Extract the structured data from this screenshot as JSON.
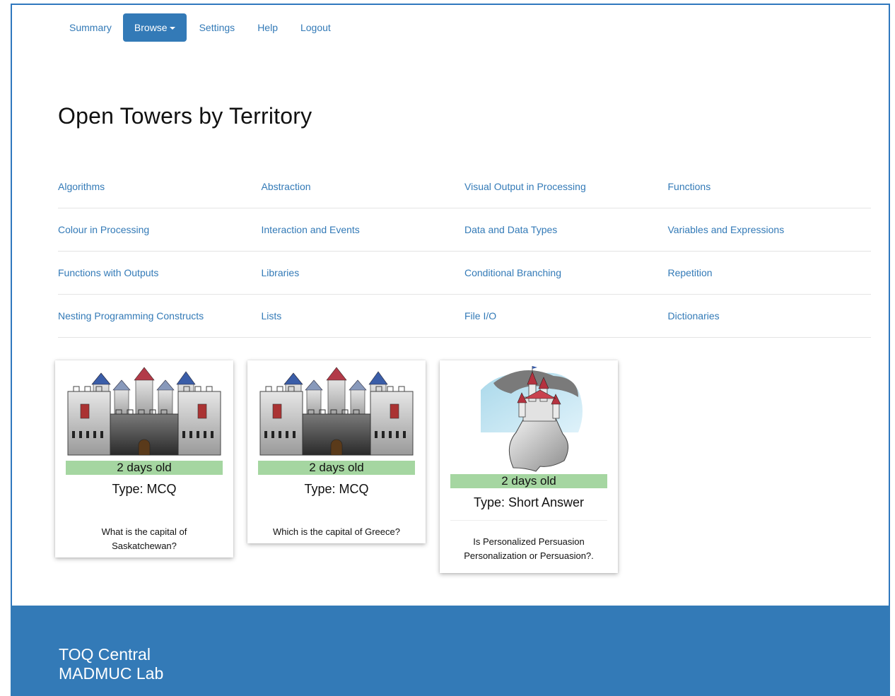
{
  "nav": {
    "items": [
      {
        "label": "Summary",
        "active": false
      },
      {
        "label": "Browse",
        "active": true,
        "dropdown": true
      },
      {
        "label": "Settings",
        "active": false
      },
      {
        "label": "Help",
        "active": false
      },
      {
        "label": "Logout",
        "active": false
      }
    ]
  },
  "page": {
    "title": "Open Towers by Territory"
  },
  "territories": [
    [
      "Algorithms",
      "Abstraction",
      "Visual Output in Processing",
      "Functions"
    ],
    [
      "Colour in Processing",
      "Interaction and Events",
      "Data and Data Types",
      "Variables and Expressions"
    ],
    [
      "Functions with Outputs",
      "Libraries",
      "Conditional Branching",
      "Repetition"
    ],
    [
      "Nesting Programming Constructs",
      "Lists",
      "File I/O",
      "Dictionaries"
    ]
  ],
  "towers": [
    {
      "image_icon": "castle-wide-icon",
      "age": "2 days old",
      "type": "Type: MCQ",
      "question": "What is the capital of Saskatchewan?"
    },
    {
      "image_icon": "castle-wide-icon",
      "age": "2 days old",
      "type": "Type: MCQ",
      "question": "Which is the capital of Greece?"
    },
    {
      "image_icon": "castle-cliff-icon",
      "age": "2 days old",
      "type": "Type: Short Answer",
      "question": "Is Personalized Persuasion Personalization or Persuasion?."
    }
  ],
  "footer": {
    "line1": "TOQ Central",
    "line2": "MADMUC Lab"
  },
  "colors": {
    "primary": "#337ab7",
    "age_bar": "#a5d6a1"
  }
}
